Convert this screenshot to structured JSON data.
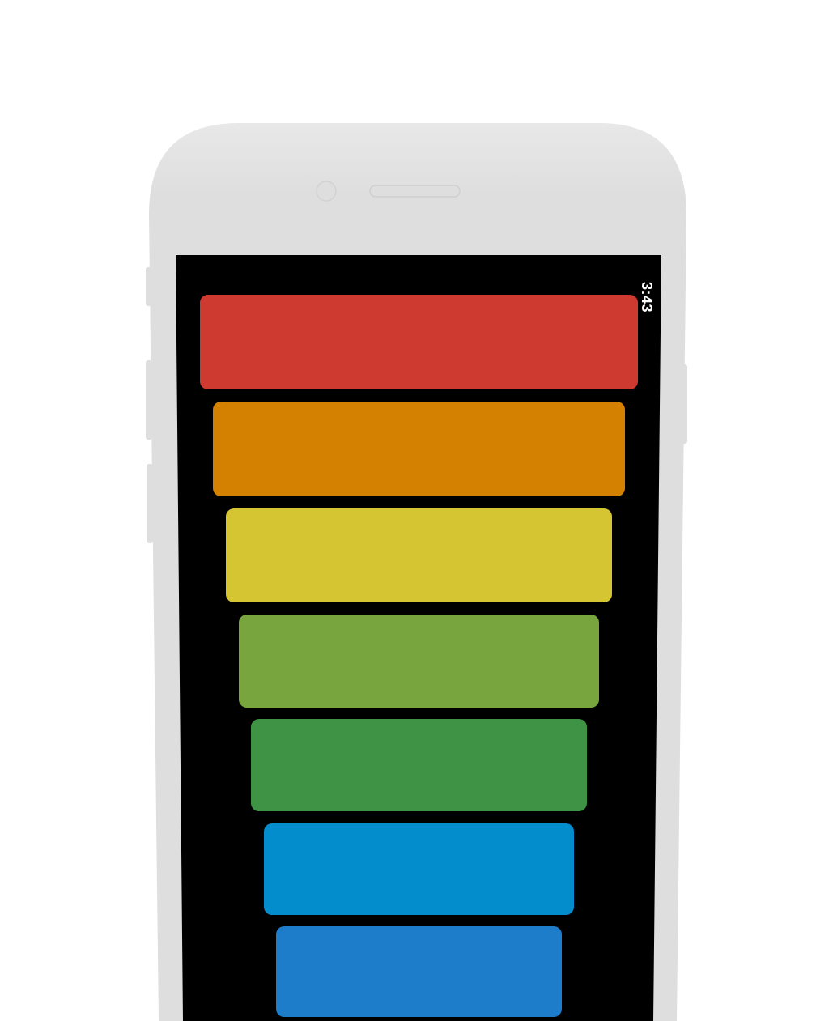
{
  "status_bar": {
    "time": "3:43"
  },
  "color_bars": [
    {
      "name": "red",
      "color": "#CF3A30"
    },
    {
      "name": "orange",
      "color": "#D48000"
    },
    {
      "name": "yellow",
      "color": "#D6C533"
    },
    {
      "name": "light-green",
      "color": "#78A53E"
    },
    {
      "name": "green",
      "color": "#3F9344"
    },
    {
      "name": "light-blue",
      "color": "#038DCD"
    },
    {
      "name": "blue",
      "color": "#1D7DCA"
    }
  ],
  "device": {
    "frame_color": "#DEDEDE",
    "screen_color": "#000000"
  }
}
